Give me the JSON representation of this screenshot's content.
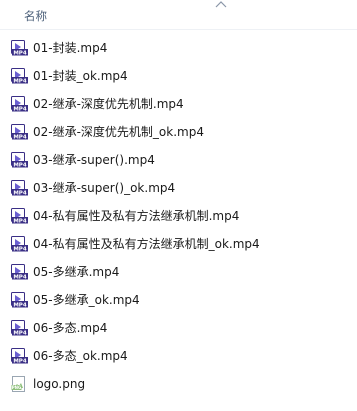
{
  "header": {
    "name_column_label": "名称",
    "sort_icon": "chevron-up-icon"
  },
  "files": [
    {
      "name": "01-封装.mp4",
      "icon": "mp4-file-icon"
    },
    {
      "name": "01-封装_ok.mp4",
      "icon": "mp4-file-icon"
    },
    {
      "name": "02-继承-深度优先机制.mp4",
      "icon": "mp4-file-icon"
    },
    {
      "name": "02-继承-深度优先机制_ok.mp4",
      "icon": "mp4-file-icon"
    },
    {
      "name": "03-继承-super().mp4",
      "icon": "mp4-file-icon"
    },
    {
      "name": "03-继承-super()_ok.mp4",
      "icon": "mp4-file-icon"
    },
    {
      "name": "04-私有属性及私有方法继承机制.mp4",
      "icon": "mp4-file-icon"
    },
    {
      "name": "04-私有属性及私有方法继承机制_ok.mp4",
      "icon": "mp4-file-icon"
    },
    {
      "name": "05-多继承.mp4",
      "icon": "mp4-file-icon"
    },
    {
      "name": "05-多继承_ok.mp4",
      "icon": "mp4-file-icon"
    },
    {
      "name": "06-多态.mp4",
      "icon": "mp4-file-icon"
    },
    {
      "name": "06-多态_ok.mp4",
      "icon": "mp4-file-icon"
    },
    {
      "name": "logo.png",
      "icon": "png-file-icon"
    }
  ],
  "colors": {
    "mp4_icon_dark": "#3a2f86",
    "mp4_icon_accent": "#6a5fd0",
    "png_icon": "#8ec07c",
    "header_text": "#4c607a"
  }
}
